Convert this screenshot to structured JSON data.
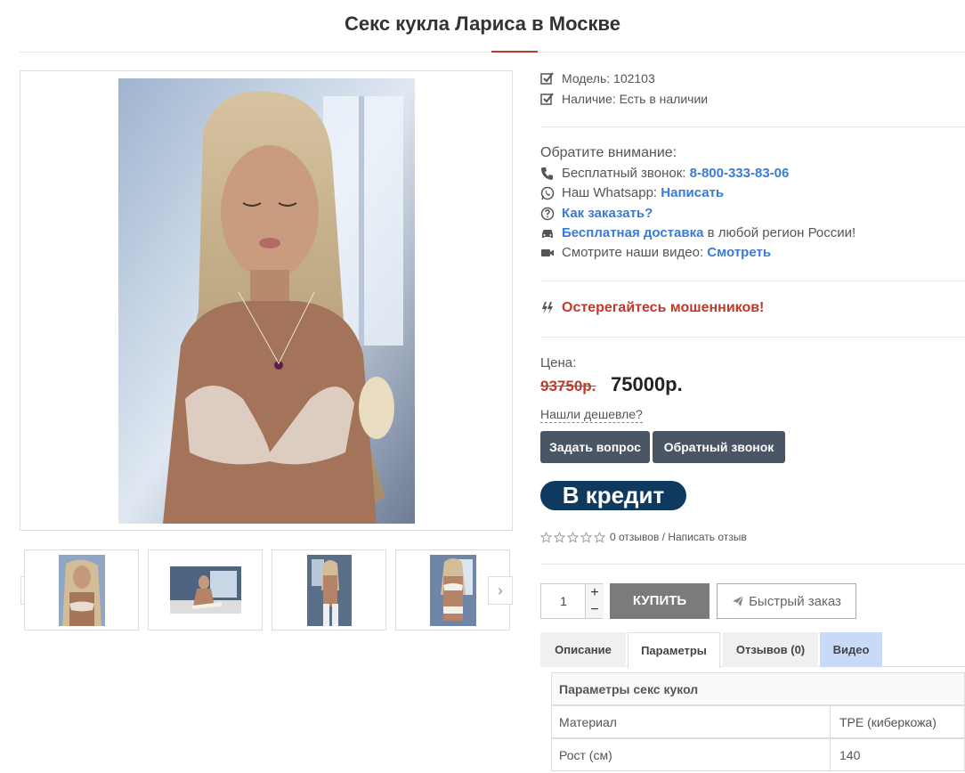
{
  "page": {
    "title": "Секс кукла Лариса в Москве"
  },
  "gallery": {
    "main_image_alt": "main product image",
    "prev_label": "‹",
    "next_label": "›"
  },
  "info": {
    "model_label": "Модель: 102103",
    "availability_label": "Наличие: Есть в наличии"
  },
  "notice": {
    "title": "Обратите внимание:",
    "phone_label": "Бесплатный звонок:",
    "phone_value": "8-800-333-83-06",
    "whatsapp_label": "Наш Whatsapp:",
    "whatsapp_link": "Написать",
    "how_to_order": "Как заказать?",
    "delivery_link": "Бесплатная доставка",
    "delivery_text": "в любой регион России!",
    "video_label": "Смотрите наши видео:",
    "video_link": "Смотреть"
  },
  "scam_warning": "Остерегайтесь мошенников!",
  "price": {
    "label": "Цена:",
    "old": "93750р.",
    "new": "75000р.",
    "cheaper_link": "Нашли дешевле?"
  },
  "buttons": {
    "ask": "Задать вопрос",
    "callback": "Обратный звонок",
    "credit": "В кредит",
    "buy": "КУПИТЬ",
    "quick_order": "Быстрый заказ"
  },
  "reviews": {
    "text": "0 отзывов / Написать отзыв",
    "rating": 0,
    "max": 5
  },
  "quantity": {
    "value": "1",
    "plus": "+",
    "minus": "−"
  },
  "tabs": [
    {
      "label": "Описание"
    },
    {
      "label": "Параметры"
    },
    {
      "label": "Отзывов (0)"
    },
    {
      "label": "Видео"
    }
  ],
  "params": {
    "header": "Параметры секс кукол",
    "rows": [
      {
        "name": "Материал",
        "value": "TPE (киберкожа)"
      },
      {
        "name": "Рост (см)",
        "value": "140"
      }
    ]
  },
  "colors": {
    "accent_red": "#c0392b",
    "link_blue": "#3a7bd5",
    "button_dark": "#4a5566",
    "credit_bg": "#0f3a5f",
    "tab_video_bg": "#c9daf8"
  }
}
